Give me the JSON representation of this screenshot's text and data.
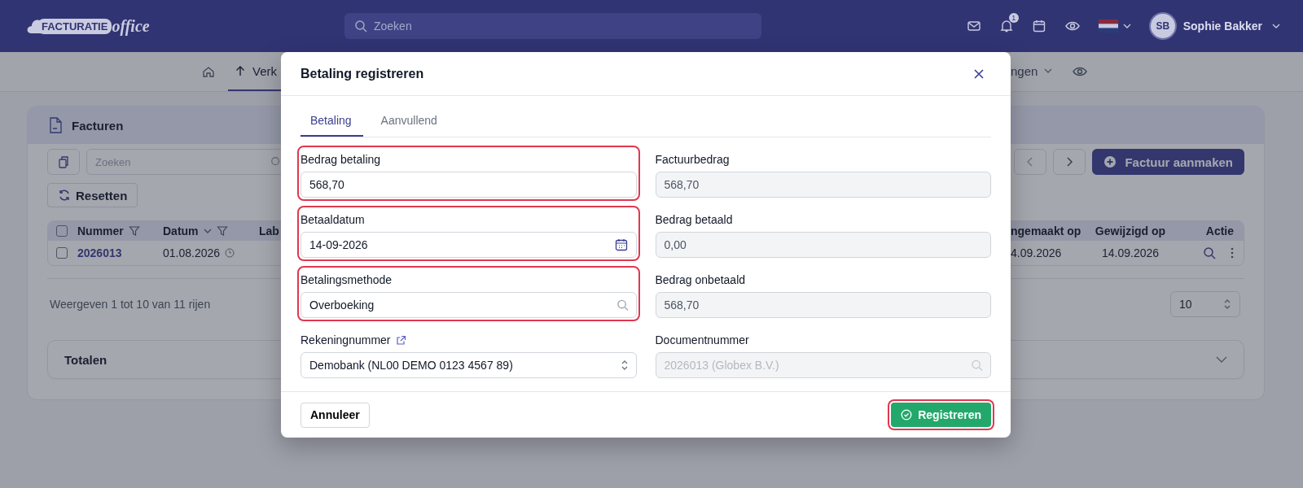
{
  "header": {
    "logo": {
      "word_1": "FACTURATIE",
      "word_2": "office"
    },
    "search": {
      "placeholder": "Zoeken"
    },
    "notification_count": "1",
    "user": {
      "initials": "SB",
      "name": "Sophie Bakker"
    }
  },
  "nav": {
    "left_items": [
      {
        "label": "Verk",
        "selected": true
      }
    ],
    "right_items": [
      {
        "label": "ngen",
        "selected": false
      }
    ]
  },
  "invoices_card": {
    "title": "Facturen",
    "search": {
      "placeholder": "Zoeken"
    },
    "reset_button": "Resetten",
    "create_button": "Factuur aanmaken",
    "table": {
      "columns_left": [
        {
          "label": "Nummer",
          "sortable": false,
          "filterable": true
        },
        {
          "label": "Datum",
          "sortable": true,
          "filterable": true
        },
        {
          "label": "Lab"
        }
      ],
      "columns_right": [
        {
          "label": "ngemaakt op"
        },
        {
          "label": "Gewijzigd op"
        },
        {
          "label": "Actie"
        }
      ],
      "rows": [
        {
          "checked": false,
          "number": "2026013",
          "date": "01.08.2026",
          "created": "4.09.2026",
          "modified": "14.09.2026"
        }
      ],
      "header_checked": false
    },
    "pagination": "Weergeven 1 tot 10 van 11 rijen",
    "page_size": "10",
    "totals": "Totalen"
  },
  "modal": {
    "title": "Betaling registreren",
    "tabs": [
      {
        "label": "Betaling",
        "selected": true
      },
      {
        "label": "Aanvullend",
        "selected": false
      }
    ],
    "left_fields": [
      {
        "label": "Bedrag betaling",
        "value": "568,70",
        "kind": "text",
        "highlighted": true,
        "external_link": false
      },
      {
        "label": "Betaaldatum",
        "value": "14-09-2026",
        "kind": "date",
        "highlighted": true,
        "external_link": false
      },
      {
        "label": "Betalingsmethode",
        "value": "Overboeking",
        "kind": "search",
        "highlighted": true,
        "external_link": false
      },
      {
        "label": "Rekeningnummer",
        "value": "Demobank (NL00 DEMO 0123 4567 89)",
        "kind": "select",
        "highlighted": false,
        "external_link": true
      }
    ],
    "right_fields": [
      {
        "label": "Factuurbedrag",
        "value": "568,70",
        "kind": "text"
      },
      {
        "label": "Bedrag betaald",
        "value": "0,00",
        "kind": "text"
      },
      {
        "label": "Bedrag onbetaald",
        "value": "568,70",
        "kind": "text"
      },
      {
        "label": "Documentnummer",
        "placeholder": "2026013 (Globex B.V.)",
        "kind": "search"
      }
    ],
    "cancel_button": "Annuleer",
    "submit_button": {
      "label": "Registreren",
      "highlighted": true
    }
  }
}
